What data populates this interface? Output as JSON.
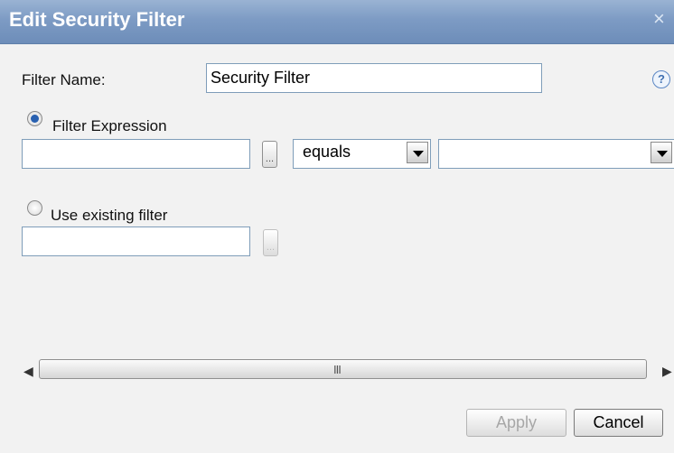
{
  "dialog": {
    "title": "Edit Security Filter",
    "close_glyph": "×"
  },
  "filter_name": {
    "label": "Filter Name:",
    "value": "Security Filter"
  },
  "help_icon": "?",
  "expression": {
    "radio_label": "Filter Expression",
    "selected": true,
    "attribute_value": "",
    "ellipsis": "...",
    "operator": "equals",
    "value": ""
  },
  "existing": {
    "radio_label": "Use existing filter",
    "selected": false,
    "filter_value": "",
    "ellipsis": "..."
  },
  "scrollbar": {
    "left_arrow": "◀",
    "right_arrow": "▶",
    "grip": "III"
  },
  "buttons": {
    "apply": "Apply",
    "cancel": "Cancel"
  },
  "colors": {
    "titlebar": "#7d9bc4",
    "radio_selected": "#2860b0",
    "help": "#3f6fb0"
  }
}
